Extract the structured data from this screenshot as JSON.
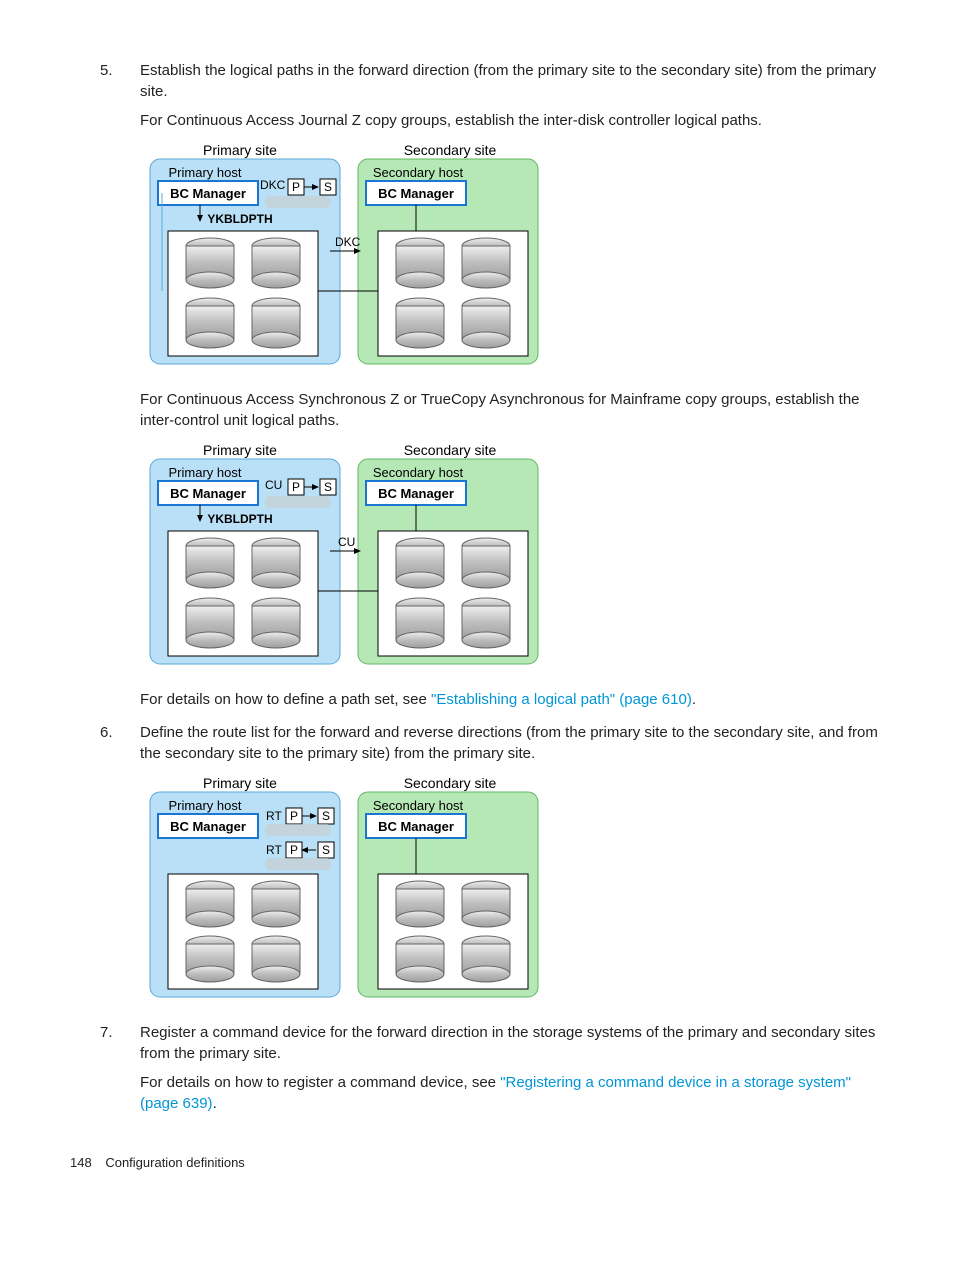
{
  "steps": {
    "s5": {
      "num": "5.",
      "p1": "Establish the logical paths in the forward direction (from the primary site to the secondary site) from the primary site.",
      "p2": "For Continuous Access Journal Z copy groups, establish the inter-disk controller logical paths.",
      "p3": "For Continuous Access Synchronous Z or TrueCopy Asynchronous for Mainframe copy groups, establish the inter-control unit logical paths.",
      "p4a": "For details on how to define a path set, see ",
      "p4link": "\"Establishing a logical path\" (page 610)",
      "p4b": "."
    },
    "s6": {
      "num": "6.",
      "p1": "Define the route list for the forward and reverse directions (from the primary site to the secondary site, and from the secondary site to the primary site) from the primary site."
    },
    "s7": {
      "num": "7.",
      "p1": "Register a command device for the forward direction in the storage systems of the primary and secondary sites from the primary site.",
      "p2a": "For details on how to register a command device, see ",
      "p2link": "\"Registering a command device in a storage system\" (page 639)",
      "p2b": "."
    }
  },
  "diagram": {
    "primary_site": "Primary site",
    "secondary_site": "Secondary site",
    "primary_host": "Primary host",
    "secondary_host": "Secondary host",
    "bc_manager": "BC Manager",
    "ykbldpth": "YKBLDPTH",
    "dkc": "DKC",
    "cu": "CU",
    "rt": "RT",
    "p": "P",
    "s": "S"
  },
  "footer": {
    "page": "148",
    "section": "Configuration definitions"
  }
}
